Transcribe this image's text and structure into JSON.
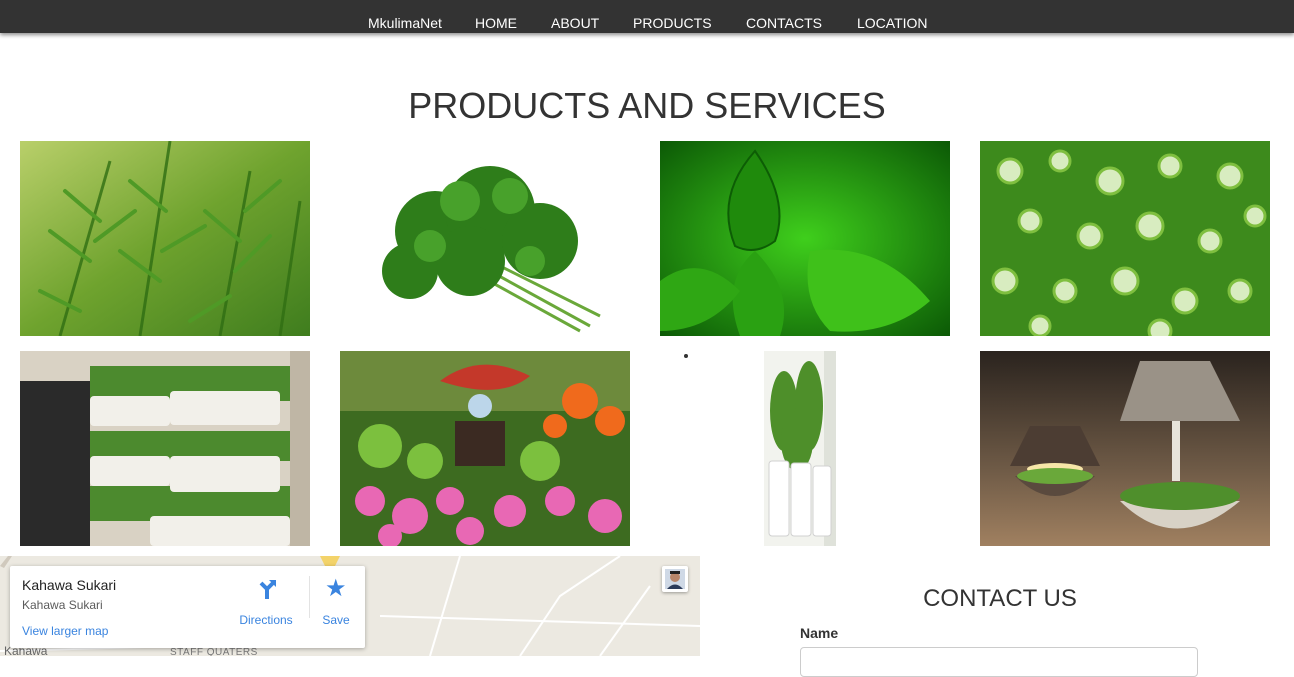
{
  "nav": {
    "brand": "MkulimaNet",
    "items": [
      "HOME",
      "ABOUT",
      "PRODUCTS",
      "CONTACTS",
      "LOCATION"
    ]
  },
  "page": {
    "title": "PRODUCTS AND SERVICES"
  },
  "products": [
    {
      "subject": "rosemary",
      "icon": "rosemary-image"
    },
    {
      "subject": "parsley",
      "icon": "parsley-image"
    },
    {
      "subject": "mint leaf",
      "icon": "mint-leaf-image"
    },
    {
      "subject": "spring onion",
      "icon": "spring-onion-image"
    },
    {
      "subject": "herb wall planters",
      "icon": "herb-wall-image"
    },
    {
      "subject": "flower garden",
      "icon": "flower-garden-image"
    },
    {
      "subject": "window herb pots",
      "icon": "window-herbs-image"
    },
    {
      "subject": "lamp planters",
      "icon": "lamp-planter-image"
    }
  ],
  "map": {
    "place_title": "Kahawa Sukari",
    "place_subtitle": "Kahawa Sukari",
    "directions_label": "Directions",
    "save_label": "Save",
    "larger_map_label": "View larger map",
    "label_kahawa": "Kahawa",
    "label_staff": "STAFF QUATERS"
  },
  "contact": {
    "title": "CONTACT US",
    "name_label": "Name",
    "name_value": ""
  },
  "colors": {
    "navbar": "#333333",
    "link_blue": "#3a84df",
    "map_bg": "#ece9e1"
  }
}
